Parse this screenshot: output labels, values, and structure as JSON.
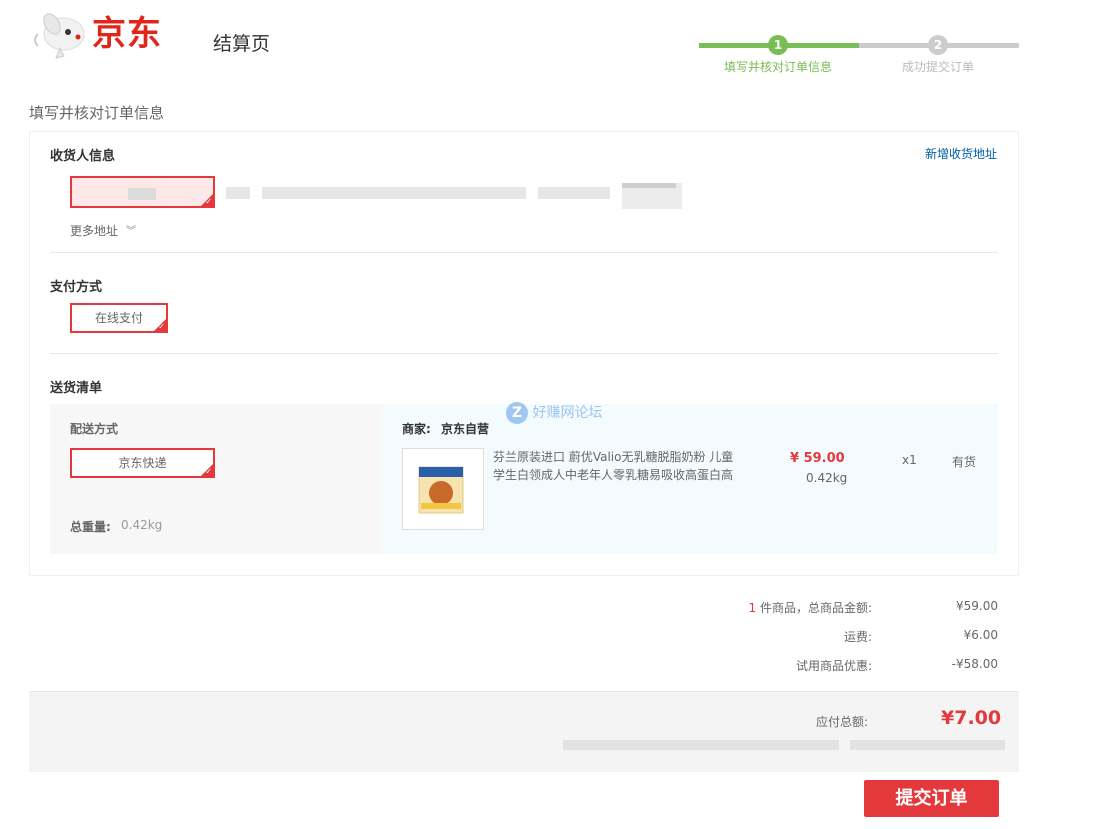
{
  "header": {
    "logo_text": "京东",
    "page_name": "结算页"
  },
  "stepper": {
    "steps": [
      {
        "num": "1",
        "label": "填写并核对订单信息",
        "state": "active"
      },
      {
        "num": "2",
        "label": "成功提交订单",
        "state": "pending"
      }
    ]
  },
  "section_heading": "填写并核对订单信息",
  "consignee": {
    "title": "收货人信息",
    "add_link": "新增收货地址",
    "more_label": "更多地址"
  },
  "payment": {
    "title": "支付方式",
    "option": "在线支付"
  },
  "shipping": {
    "title": "送货清单",
    "method_label": "配送方式",
    "method_option": "京东快递",
    "total_weight_label": "总重量:",
    "total_weight_value": "0.42kg",
    "seller_label": "商家:",
    "seller_value": "京东自营",
    "watermark": "好赚网论坛",
    "product": {
      "title": "芬兰原装进口 蔚优Valio无乳糖脱脂奶粉 儿童学生白领成人中老年人零乳糖易吸收高蛋白高",
      "price": "¥ 59.00",
      "weight": "0.42kg",
      "qty": "x1",
      "stock": "有货"
    }
  },
  "summary": {
    "count": "1",
    "count_suffix": "件商品，总商品金额:",
    "goods_total": "¥59.00",
    "freight_label": "运费:",
    "freight": "¥6.00",
    "discount_label": "试用商品优惠:",
    "discount": "-¥58.00"
  },
  "pay": {
    "total_label": "应付总额:",
    "total_value": "¥7.00",
    "submit_label": "提交订单"
  },
  "colors": {
    "brand_red": "#e4393c",
    "step_green": "#7abd54",
    "link_blue": "#005ea7"
  }
}
